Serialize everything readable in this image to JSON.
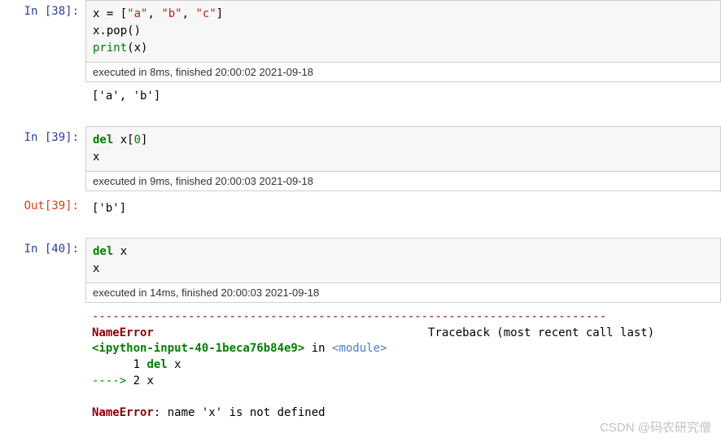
{
  "cells": [
    {
      "in_prompt": "In  [38]:",
      "code_tokens": [
        [
          {
            "t": "x = [",
            "c": ""
          },
          {
            "t": "\"a\"",
            "c": "tok-str"
          },
          {
            "t": ", ",
            "c": ""
          },
          {
            "t": "\"b\"",
            "c": "tok-str"
          },
          {
            "t": ", ",
            "c": ""
          },
          {
            "t": "\"c\"",
            "c": "tok-str"
          },
          {
            "t": "]",
            "c": ""
          }
        ],
        [
          {
            "t": "x.pop()",
            "c": ""
          }
        ],
        [
          {
            "t": "print",
            "c": "tok-builtin"
          },
          {
            "t": "(x)",
            "c": ""
          }
        ]
      ],
      "exec": "executed in 8ms, finished 20:00:02 2021-09-18",
      "out_prompt": "",
      "output": "['a', 'b']"
    },
    {
      "in_prompt": "In  [39]:",
      "code_tokens": [
        [
          {
            "t": "del",
            "c": "tok-keyword"
          },
          {
            "t": " x[",
            "c": ""
          },
          {
            "t": "0",
            "c": "tok-builtin"
          },
          {
            "t": "]",
            "c": ""
          }
        ],
        [
          {
            "t": "x",
            "c": ""
          }
        ]
      ],
      "exec": "executed in 9ms, finished 20:00:03 2021-09-18",
      "out_prompt": "Out[39]:",
      "output": "['b']"
    },
    {
      "in_prompt": "In  [40]:",
      "code_tokens": [
        [
          {
            "t": "del",
            "c": "tok-keyword"
          },
          {
            "t": " x",
            "c": ""
          }
        ],
        [
          {
            "t": "x",
            "c": ""
          }
        ]
      ],
      "exec": "executed in 14ms, finished 20:00:03 2021-09-18",
      "out_prompt": "",
      "error": {
        "dashes": "---------------------------------------------------------------------------",
        "header_name": "NameError",
        "header_trace": "Traceback (most recent call last)",
        "input_ref": "<ipython-input-40-1beca76b84e9>",
        "in_word": " in ",
        "module": "<module>",
        "line1a": "      1 ",
        "line1b": "del",
        "line1c": " x",
        "line2a": "----> ",
        "line2b": "2",
        "line2c": " x",
        "final_name": "NameError",
        "final_msg": ": name 'x' is not defined"
      }
    }
  ],
  "watermark": "CSDN @码农研究僧"
}
